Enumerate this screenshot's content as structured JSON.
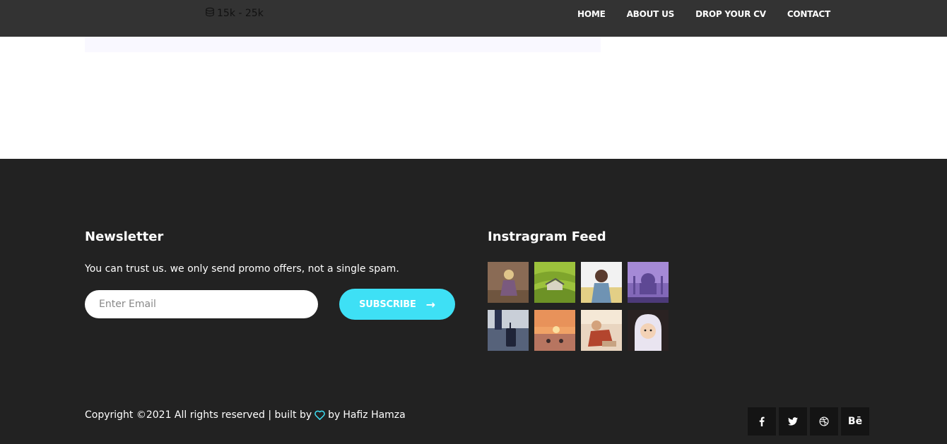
{
  "header": {
    "salary": "15k - 25k",
    "nav": [
      "HOME",
      "ABOUT US",
      "DROP YOUR CV",
      "CONTACT"
    ]
  },
  "newsletter": {
    "title": "Newsletter",
    "text": "You can trust us. we only send promo offers, not a single spam.",
    "placeholder": "Enter Email",
    "button_label": "SUBSCRIBE",
    "button_icon": "arrow-right-icon"
  },
  "instagram": {
    "title": "Instragram Feed"
  },
  "footer": {
    "copyright_prefix": "Copyright ©2021 All rights reserved | built by",
    "by_text": "by",
    "author": "Hafiz Hamza",
    "social": [
      "f",
      "t",
      "d",
      "Bē"
    ]
  },
  "colors": {
    "accent": "#3ee0f5",
    "nav_bg": "#333333",
    "footer_bg": "#222222"
  }
}
